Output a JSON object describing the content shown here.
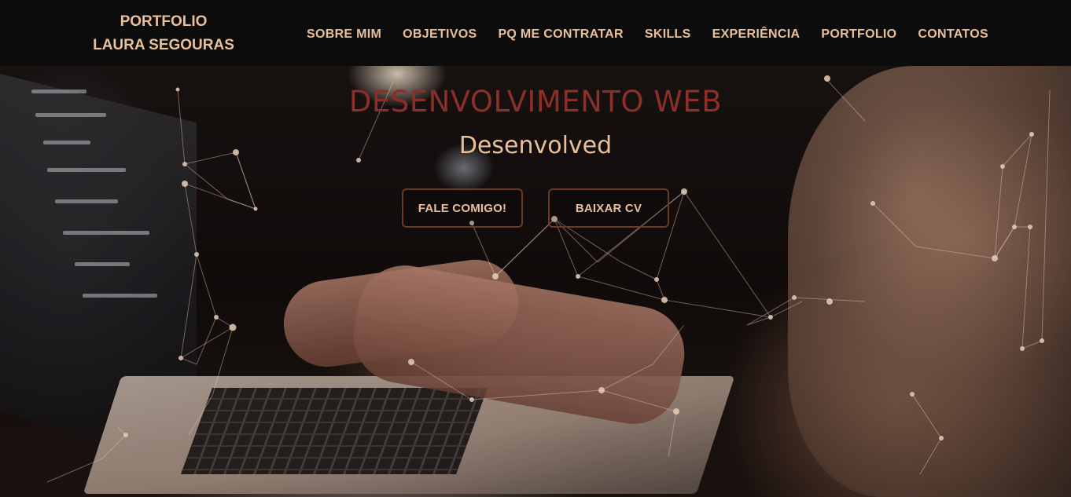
{
  "brand": {
    "line1": "PORTFOLIO",
    "line2": "LAURA SEGOURAS"
  },
  "nav": {
    "items": [
      {
        "label": "SOBRE MIM"
      },
      {
        "label": "OBJETIVOS"
      },
      {
        "label": "PQ ME CONTRATAR"
      },
      {
        "label": "SKILLS"
      },
      {
        "label": "EXPERIÊNCIA"
      },
      {
        "label": "PORTFOLIO"
      },
      {
        "label": "CONTATOS"
      }
    ]
  },
  "hero": {
    "title": "DESENVOLVIMENTO WEB",
    "subtitle": "Desenvolved",
    "primary_button": "FALE COMIGO!",
    "secondary_button": "BAIXAR CV",
    "background_icon": "laptop-typing-photo-icon"
  },
  "colors": {
    "nav_bg": "#0d0c0c",
    "accent_text": "#e8c09a",
    "title_red": "#8a2f2a",
    "button_border": "#6b3a24"
  }
}
